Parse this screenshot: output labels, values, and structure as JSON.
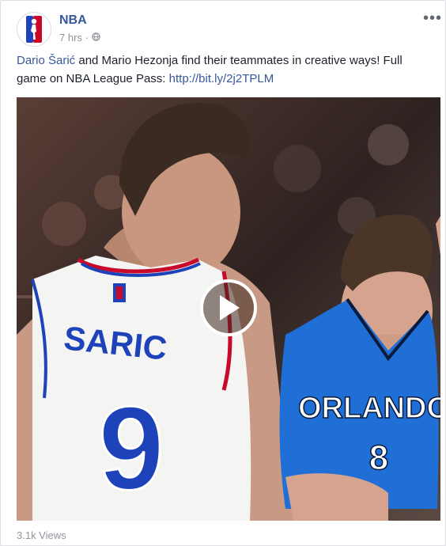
{
  "post": {
    "page_name": "NBA",
    "time": "7 hrs",
    "separator": "·",
    "options_label": "•••",
    "text_pre": "Dario Šarić",
    "text_mid": " and Mario Hezonja find their teammates in creative ways! Full game on NBA League Pass: ",
    "link": "http://bit.ly/2j2TPLM",
    "views": "3.1k Views"
  },
  "video": {
    "jersey_left_name": "SARIC",
    "jersey_left_number": "9",
    "jersey_right_team": "ORLANDO",
    "jersey_right_number": "8"
  },
  "colors": {
    "link": "#365899",
    "meta": "#90949c",
    "sixers_blue": "#1d42ba",
    "magic_blue": "#1f6fd6"
  },
  "icons": {
    "logo": "nba-logo-icon",
    "privacy": "globe-icon",
    "options": "more-options-icon",
    "play": "play-icon"
  }
}
